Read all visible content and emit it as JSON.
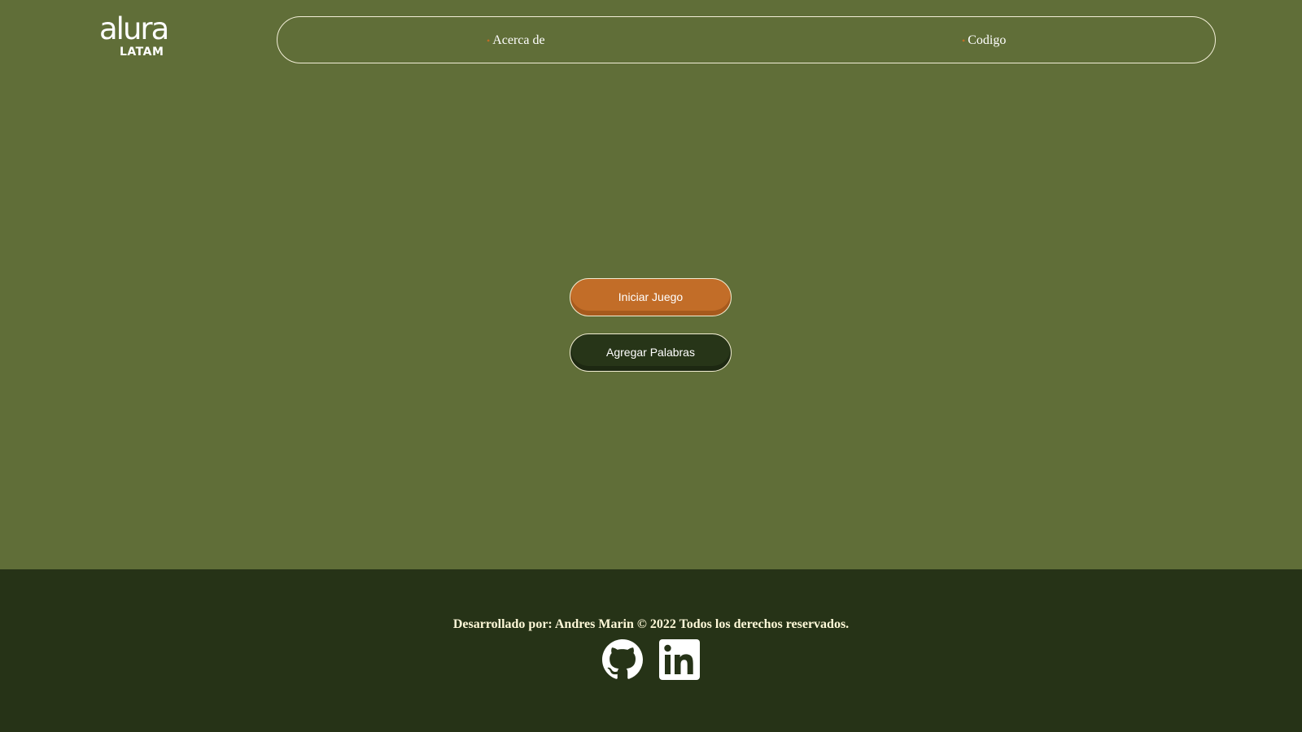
{
  "header": {
    "logo": {
      "main": "alura",
      "sub": "LATAM"
    },
    "nav": {
      "items": [
        {
          "label": "Acerca de"
        },
        {
          "label": "Codigo"
        }
      ],
      "bullet": "•"
    }
  },
  "main": {
    "start_button": "Iniciar Juego",
    "add_words_button": "Agregar Palabras"
  },
  "footer": {
    "credits": "Desarrollado por: Andres Marin © 2022 Todos los derechos reservados.",
    "social_icons": [
      "github-icon",
      "linkedin-icon"
    ]
  },
  "colors": {
    "background": "#606e38",
    "footer_background": "#263317",
    "accent_orange": "#c26d28",
    "dark_green": "#273518",
    "text_light": "#fff9d9"
  }
}
